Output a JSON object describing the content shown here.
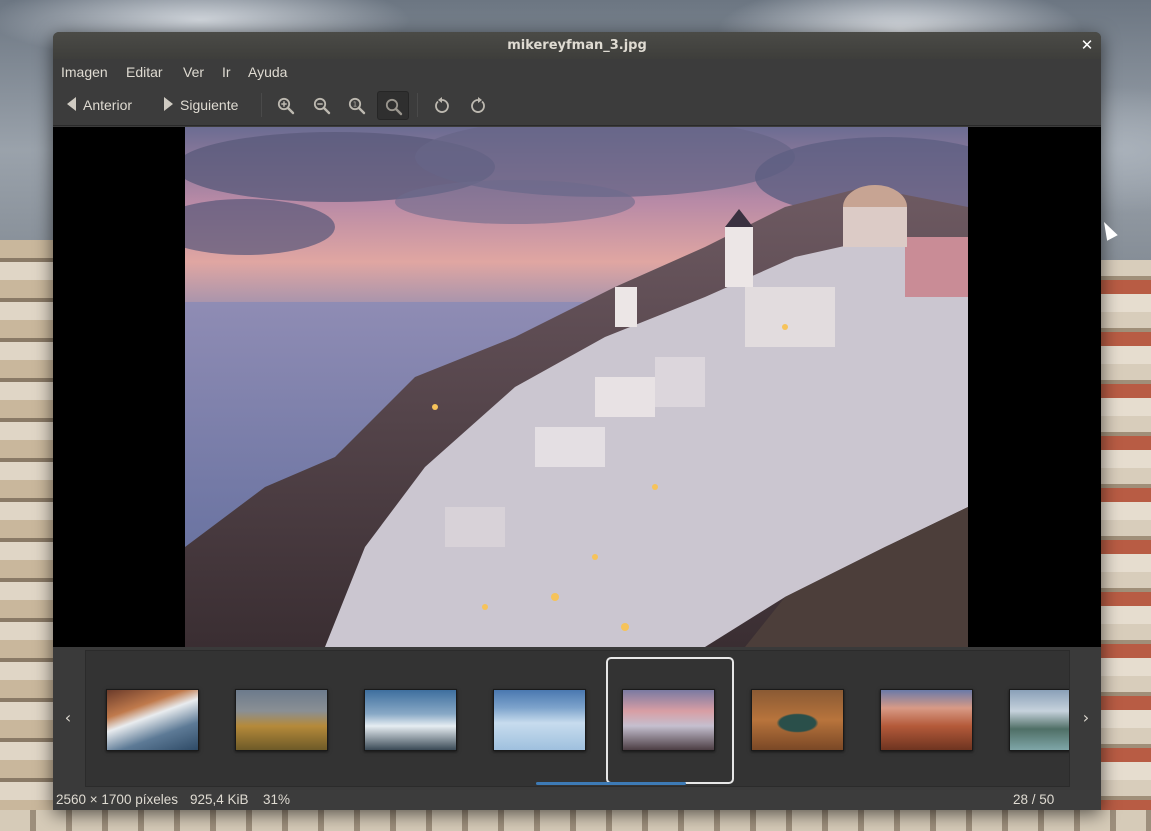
{
  "window": {
    "title": "mikereyfman_3.jpg",
    "close_icon": "close-icon"
  },
  "menu": {
    "items": [
      "Imagen",
      "Editar",
      "Ver",
      "Ir",
      "Ayuda"
    ]
  },
  "toolbar": {
    "prev_label": "Anterior",
    "next_label": "Siguiente",
    "icons": [
      "zoom-in-icon",
      "zoom-out-icon",
      "zoom-normal-icon",
      "zoom-fit-icon",
      "rotate-left-icon",
      "rotate-right-icon"
    ]
  },
  "thumbnails": {
    "items": [
      {
        "name": "thumb-architecture"
      },
      {
        "name": "thumb-mountains-autumn"
      },
      {
        "name": "thumb-waves"
      },
      {
        "name": "thumb-glacier"
      },
      {
        "name": "thumb-santorini",
        "selected": true
      },
      {
        "name": "thumb-horseshoe-bend"
      },
      {
        "name": "thumb-canyon"
      },
      {
        "name": "thumb-lake-mountains"
      }
    ],
    "prev_icon": "chevron-left-icon",
    "next_icon": "chevron-right-icon"
  },
  "status": {
    "dimensions": "2560 × 1700 píxeles",
    "size": "925,4 KiB",
    "zoom": "31%",
    "position": "28 / 50"
  }
}
